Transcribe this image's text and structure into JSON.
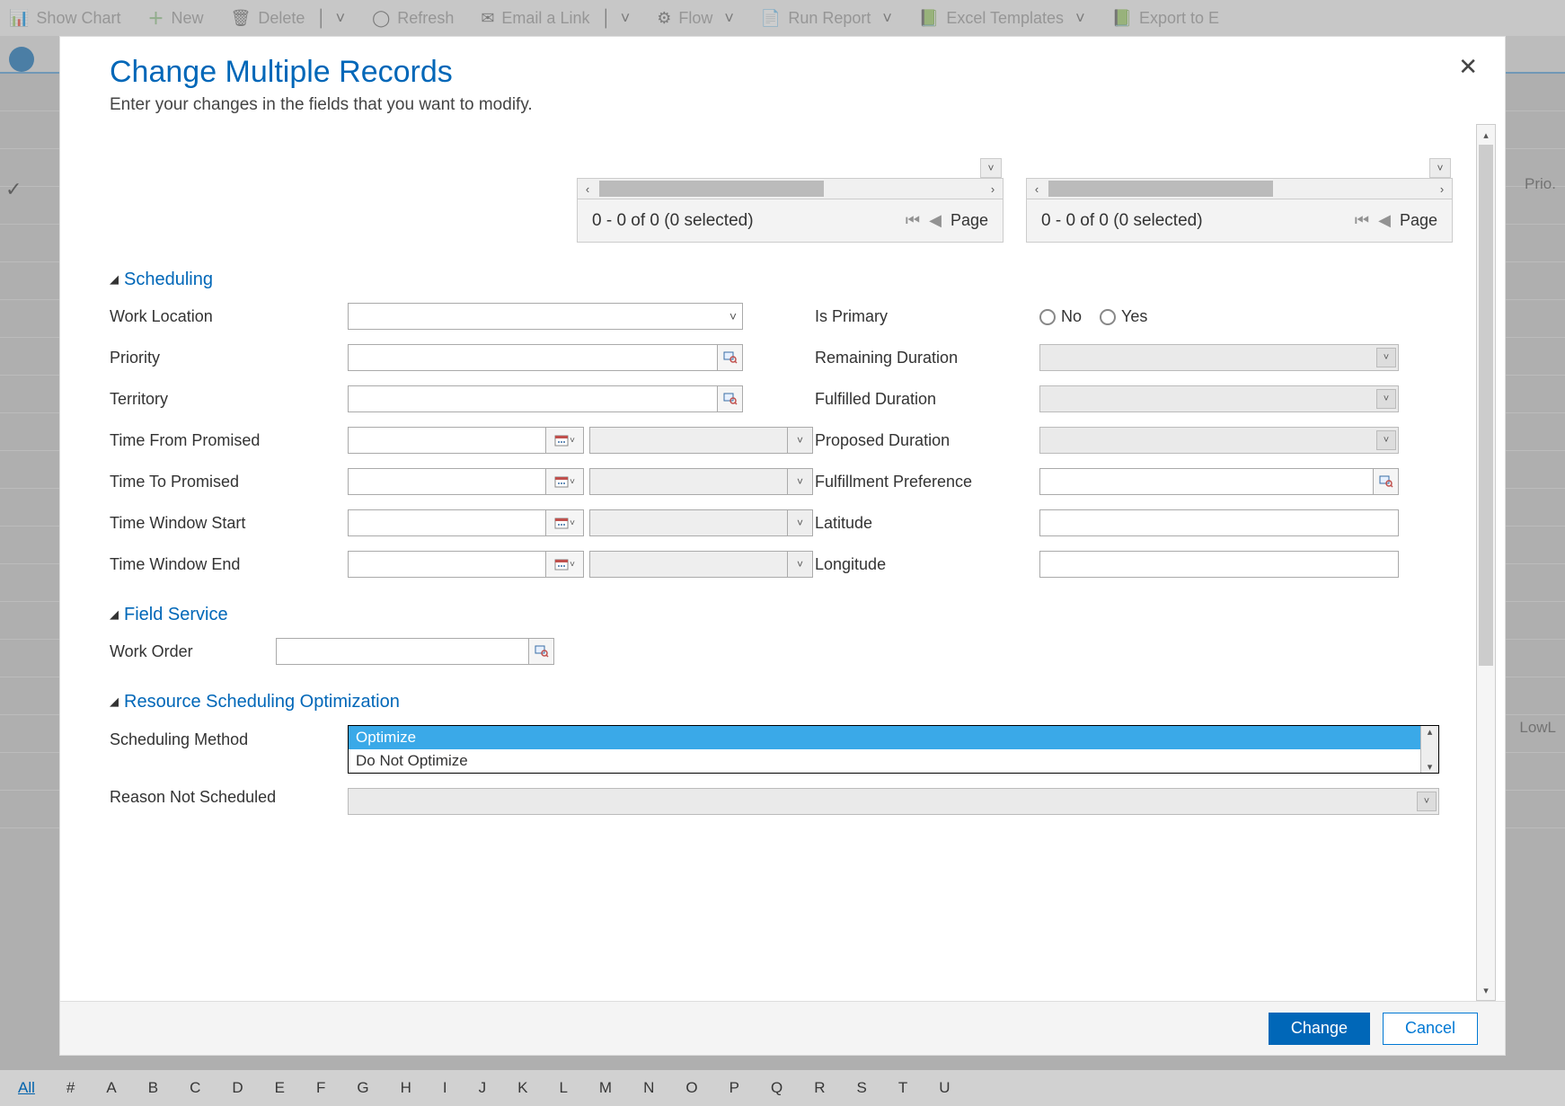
{
  "bg_toolbar": {
    "show_chart": "Show Chart",
    "new": "New",
    "delete": "Delete",
    "refresh": "Refresh",
    "email_link": "Email a Link",
    "flow": "Flow",
    "run_report": "Run Report",
    "excel_templates": "Excel Templates",
    "export": "Export to E"
  },
  "bg_right": {
    "prio": "Prio.",
    "lowl": "LowL"
  },
  "letters": [
    "All",
    "#",
    "A",
    "B",
    "C",
    "D",
    "E",
    "F",
    "G",
    "H",
    "I",
    "J",
    "K",
    "L",
    "M",
    "N",
    "O",
    "P",
    "Q",
    "R",
    "S",
    "T",
    "U"
  ],
  "modal": {
    "title": "Change Multiple Records",
    "subtitle": "Enter your changes in the fields that you want to modify.",
    "close": "✕"
  },
  "grid": {
    "status": "0 - 0 of 0 (0 selected)",
    "page": "Page"
  },
  "sections": {
    "scheduling": "Scheduling",
    "field_service": "Field Service",
    "rso": "Resource Scheduling Optimization"
  },
  "labels": {
    "work_location": "Work Location",
    "priority": "Priority",
    "territory": "Territory",
    "time_from_promised": "Time From Promised",
    "time_to_promised": "Time To Promised",
    "time_window_start": "Time Window Start",
    "time_window_end": "Time Window End",
    "is_primary": "Is Primary",
    "remaining_duration": "Remaining Duration",
    "fulfilled_duration": "Fulfilled Duration",
    "proposed_duration": "Proposed Duration",
    "fulfillment_preference": "Fulfillment Preference",
    "latitude": "Latitude",
    "longitude": "Longitude",
    "work_order": "Work Order",
    "scheduling_method": "Scheduling Method",
    "reason_not_scheduled": "Reason Not Scheduled"
  },
  "radios": {
    "no": "No",
    "yes": "Yes"
  },
  "dropdown": {
    "option_selected": "Optimize",
    "option_other": "Do Not Optimize"
  },
  "footer": {
    "change": "Change",
    "cancel": "Cancel"
  }
}
